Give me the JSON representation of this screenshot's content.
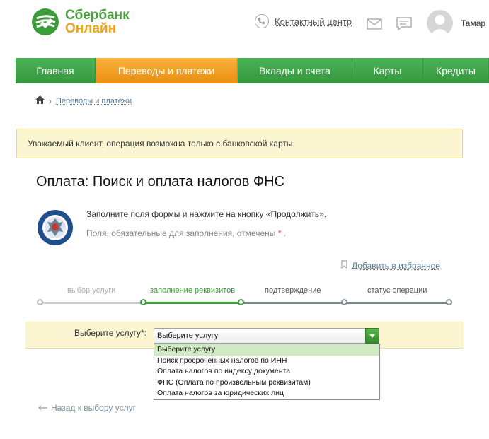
{
  "brand": {
    "name_line1": "Сбербанк",
    "name_line2": "Онлайн",
    "green": "#4a9e3b",
    "orange": "#f0a31c"
  },
  "header": {
    "contact_label": "Контактный центр",
    "user_name": "Тамар"
  },
  "nav": {
    "items": [
      {
        "label": "Главная"
      },
      {
        "label": "Переводы и платежи"
      },
      {
        "label": "Вклады и счета"
      },
      {
        "label": "Карты"
      },
      {
        "label": "Кредиты"
      }
    ],
    "active_index": 1
  },
  "breadcrumb": {
    "link": "Переводы и платежи"
  },
  "warning": "Уважаемый клиент, операция возможна только с банковской карты.",
  "page": {
    "title": "Оплата: Поиск и оплата налогов ФНС",
    "hint_primary": "Заполните поля формы и нажмите на кнопку «Продолжить».",
    "hint_secondary": "Поля, обязательные для заполнения, отмечены",
    "required_mark": "*",
    "hint_end": ".",
    "favorite_label": "Добавить в избранное"
  },
  "steps": [
    {
      "label": "выбор услуги",
      "state": "done"
    },
    {
      "label": "заполнение реквизитов",
      "state": "active"
    },
    {
      "label": "подтверждение",
      "state": "pending"
    },
    {
      "label": "статус операции",
      "state": "pending"
    }
  ],
  "service": {
    "label": "Выберите услугу*:",
    "selected": "Выберите услугу",
    "options": [
      "Выберите услугу",
      "Поиск просроченных налогов по ИНН",
      "Оплата налогов по индексу документа",
      "ФНС (Оплата по произвольным реквизитам)",
      "Оплата налогов за юридических лиц"
    ]
  },
  "back_link": "Назад к выбору услуг"
}
